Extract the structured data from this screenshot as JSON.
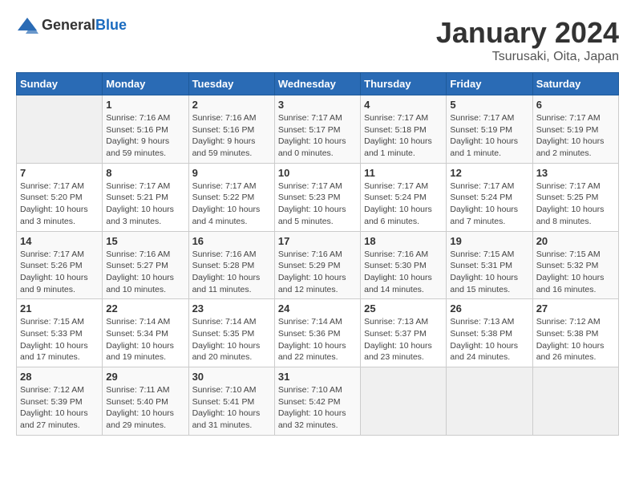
{
  "header": {
    "logo_general": "General",
    "logo_blue": "Blue",
    "month_year": "January 2024",
    "location": "Tsurusaki, Oita, Japan"
  },
  "days_of_week": [
    "Sunday",
    "Monday",
    "Tuesday",
    "Wednesday",
    "Thursday",
    "Friday",
    "Saturday"
  ],
  "weeks": [
    [
      {
        "day": "",
        "info": ""
      },
      {
        "day": "1",
        "info": "Sunrise: 7:16 AM\nSunset: 5:16 PM\nDaylight: 9 hours\nand 59 minutes."
      },
      {
        "day": "2",
        "info": "Sunrise: 7:16 AM\nSunset: 5:16 PM\nDaylight: 9 hours\nand 59 minutes."
      },
      {
        "day": "3",
        "info": "Sunrise: 7:17 AM\nSunset: 5:17 PM\nDaylight: 10 hours\nand 0 minutes."
      },
      {
        "day": "4",
        "info": "Sunrise: 7:17 AM\nSunset: 5:18 PM\nDaylight: 10 hours\nand 1 minute."
      },
      {
        "day": "5",
        "info": "Sunrise: 7:17 AM\nSunset: 5:19 PM\nDaylight: 10 hours\nand 1 minute."
      },
      {
        "day": "6",
        "info": "Sunrise: 7:17 AM\nSunset: 5:19 PM\nDaylight: 10 hours\nand 2 minutes."
      }
    ],
    [
      {
        "day": "7",
        "info": "Sunrise: 7:17 AM\nSunset: 5:20 PM\nDaylight: 10 hours\nand 3 minutes."
      },
      {
        "day": "8",
        "info": "Sunrise: 7:17 AM\nSunset: 5:21 PM\nDaylight: 10 hours\nand 3 minutes."
      },
      {
        "day": "9",
        "info": "Sunrise: 7:17 AM\nSunset: 5:22 PM\nDaylight: 10 hours\nand 4 minutes."
      },
      {
        "day": "10",
        "info": "Sunrise: 7:17 AM\nSunset: 5:23 PM\nDaylight: 10 hours\nand 5 minutes."
      },
      {
        "day": "11",
        "info": "Sunrise: 7:17 AM\nSunset: 5:24 PM\nDaylight: 10 hours\nand 6 minutes."
      },
      {
        "day": "12",
        "info": "Sunrise: 7:17 AM\nSunset: 5:24 PM\nDaylight: 10 hours\nand 7 minutes."
      },
      {
        "day": "13",
        "info": "Sunrise: 7:17 AM\nSunset: 5:25 PM\nDaylight: 10 hours\nand 8 minutes."
      }
    ],
    [
      {
        "day": "14",
        "info": "Sunrise: 7:17 AM\nSunset: 5:26 PM\nDaylight: 10 hours\nand 9 minutes."
      },
      {
        "day": "15",
        "info": "Sunrise: 7:16 AM\nSunset: 5:27 PM\nDaylight: 10 hours\nand 10 minutes."
      },
      {
        "day": "16",
        "info": "Sunrise: 7:16 AM\nSunset: 5:28 PM\nDaylight: 10 hours\nand 11 minutes."
      },
      {
        "day": "17",
        "info": "Sunrise: 7:16 AM\nSunset: 5:29 PM\nDaylight: 10 hours\nand 12 minutes."
      },
      {
        "day": "18",
        "info": "Sunrise: 7:16 AM\nSunset: 5:30 PM\nDaylight: 10 hours\nand 14 minutes."
      },
      {
        "day": "19",
        "info": "Sunrise: 7:15 AM\nSunset: 5:31 PM\nDaylight: 10 hours\nand 15 minutes."
      },
      {
        "day": "20",
        "info": "Sunrise: 7:15 AM\nSunset: 5:32 PM\nDaylight: 10 hours\nand 16 minutes."
      }
    ],
    [
      {
        "day": "21",
        "info": "Sunrise: 7:15 AM\nSunset: 5:33 PM\nDaylight: 10 hours\nand 17 minutes."
      },
      {
        "day": "22",
        "info": "Sunrise: 7:14 AM\nSunset: 5:34 PM\nDaylight: 10 hours\nand 19 minutes."
      },
      {
        "day": "23",
        "info": "Sunrise: 7:14 AM\nSunset: 5:35 PM\nDaylight: 10 hours\nand 20 minutes."
      },
      {
        "day": "24",
        "info": "Sunrise: 7:14 AM\nSunset: 5:36 PM\nDaylight: 10 hours\nand 22 minutes."
      },
      {
        "day": "25",
        "info": "Sunrise: 7:13 AM\nSunset: 5:37 PM\nDaylight: 10 hours\nand 23 minutes."
      },
      {
        "day": "26",
        "info": "Sunrise: 7:13 AM\nSunset: 5:38 PM\nDaylight: 10 hours\nand 24 minutes."
      },
      {
        "day": "27",
        "info": "Sunrise: 7:12 AM\nSunset: 5:38 PM\nDaylight: 10 hours\nand 26 minutes."
      }
    ],
    [
      {
        "day": "28",
        "info": "Sunrise: 7:12 AM\nSunset: 5:39 PM\nDaylight: 10 hours\nand 27 minutes."
      },
      {
        "day": "29",
        "info": "Sunrise: 7:11 AM\nSunset: 5:40 PM\nDaylight: 10 hours\nand 29 minutes."
      },
      {
        "day": "30",
        "info": "Sunrise: 7:10 AM\nSunset: 5:41 PM\nDaylight: 10 hours\nand 31 minutes."
      },
      {
        "day": "31",
        "info": "Sunrise: 7:10 AM\nSunset: 5:42 PM\nDaylight: 10 hours\nand 32 minutes."
      },
      {
        "day": "",
        "info": ""
      },
      {
        "day": "",
        "info": ""
      },
      {
        "day": "",
        "info": ""
      }
    ]
  ]
}
